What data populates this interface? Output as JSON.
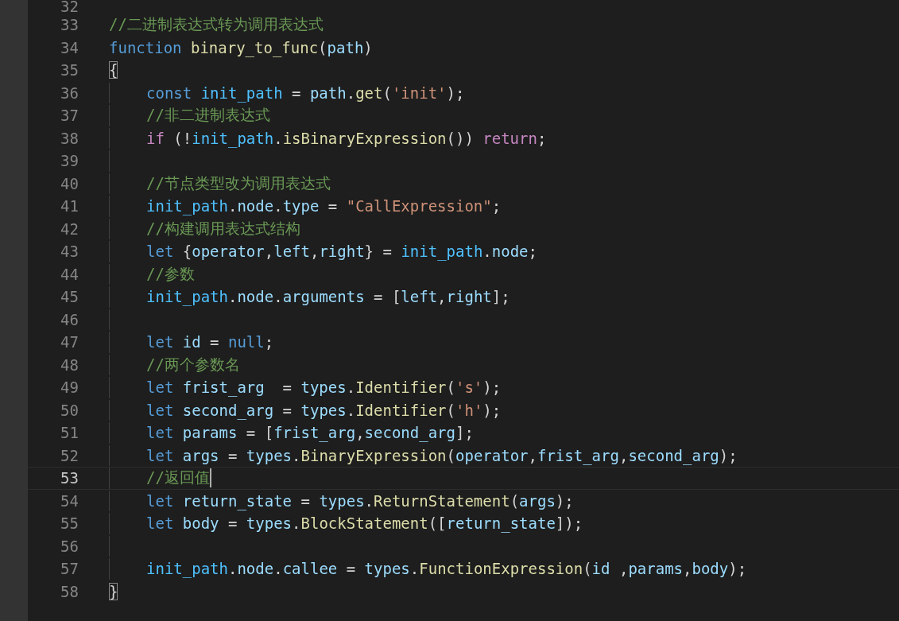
{
  "editor": {
    "lines": [
      {
        "number": "32",
        "current": false,
        "indented": false
      },
      {
        "number": "33",
        "current": false,
        "indented": false,
        "tokens": [
          {
            "kind": "comment",
            "text": "//二进制表达式转为调用表达式"
          }
        ]
      },
      {
        "number": "34",
        "current": false,
        "indented": false,
        "tokens": [
          {
            "kind": "keyword",
            "text": "function"
          },
          {
            "kind": "function",
            "text": " binary_to_func"
          },
          {
            "kind": "plain",
            "text": "("
          },
          {
            "kind": "variable",
            "text": "path"
          },
          {
            "kind": "plain",
            "text": ")"
          }
        ]
      },
      {
        "number": "35",
        "current": false,
        "indented": false,
        "tokens": [
          {
            "kind": "brace_match",
            "text": "{"
          }
        ]
      },
      {
        "number": "36",
        "current": false,
        "indented": true,
        "tokens": [
          {
            "kind": "keyword",
            "text": "const"
          },
          {
            "kind": "constant",
            "text": " init_path"
          },
          {
            "kind": "plain",
            "text": " = "
          },
          {
            "kind": "variable",
            "text": "path"
          },
          {
            "kind": "plain",
            "text": "."
          },
          {
            "kind": "function",
            "text": "get"
          },
          {
            "kind": "plain",
            "text": "("
          },
          {
            "kind": "string",
            "text": "'init'"
          },
          {
            "kind": "plain",
            "text": ");"
          }
        ]
      },
      {
        "number": "37",
        "current": false,
        "indented": true,
        "tokens": [
          {
            "kind": "comment",
            "text": "//非二进制表达式"
          }
        ]
      },
      {
        "number": "38",
        "current": false,
        "indented": true,
        "tokens": [
          {
            "kind": "control",
            "text": "if"
          },
          {
            "kind": "plain",
            "text": " (!"
          },
          {
            "kind": "constant",
            "text": "init_path"
          },
          {
            "kind": "plain",
            "text": "."
          },
          {
            "kind": "function",
            "text": "isBinaryExpression"
          },
          {
            "kind": "plain",
            "text": "()) "
          },
          {
            "kind": "control",
            "text": "return"
          },
          {
            "kind": "plain",
            "text": ";"
          }
        ]
      },
      {
        "number": "39",
        "current": false,
        "indented": true
      },
      {
        "number": "40",
        "current": false,
        "indented": true,
        "tokens": [
          {
            "kind": "comment",
            "text": "//节点类型改为调用表达式"
          }
        ]
      },
      {
        "number": "41",
        "current": false,
        "indented": true,
        "tokens": [
          {
            "kind": "constant",
            "text": "init_path"
          },
          {
            "kind": "plain",
            "text": "."
          },
          {
            "kind": "variable",
            "text": "node"
          },
          {
            "kind": "plain",
            "text": "."
          },
          {
            "kind": "variable",
            "text": "type"
          },
          {
            "kind": "plain",
            "text": " = "
          },
          {
            "kind": "string",
            "text": "\"CallExpression\""
          },
          {
            "kind": "plain",
            "text": ";"
          }
        ]
      },
      {
        "number": "42",
        "current": false,
        "indented": true,
        "tokens": [
          {
            "kind": "comment",
            "text": "//构建调用表达式结构"
          }
        ]
      },
      {
        "number": "43",
        "current": false,
        "indented": true,
        "tokens": [
          {
            "kind": "keyword",
            "text": "let"
          },
          {
            "kind": "plain",
            "text": " {"
          },
          {
            "kind": "variable",
            "text": "operator"
          },
          {
            "kind": "plain",
            "text": ","
          },
          {
            "kind": "variable",
            "text": "left"
          },
          {
            "kind": "plain",
            "text": ","
          },
          {
            "kind": "variable",
            "text": "right"
          },
          {
            "kind": "plain",
            "text": "} = "
          },
          {
            "kind": "constant",
            "text": "init_path"
          },
          {
            "kind": "plain",
            "text": "."
          },
          {
            "kind": "variable",
            "text": "node"
          },
          {
            "kind": "plain",
            "text": ";"
          }
        ]
      },
      {
        "number": "44",
        "current": false,
        "indented": true,
        "tokens": [
          {
            "kind": "comment",
            "text": "//参数"
          }
        ]
      },
      {
        "number": "45",
        "current": false,
        "indented": true,
        "tokens": [
          {
            "kind": "constant",
            "text": "init_path"
          },
          {
            "kind": "plain",
            "text": "."
          },
          {
            "kind": "variable",
            "text": "node"
          },
          {
            "kind": "plain",
            "text": "."
          },
          {
            "kind": "variable",
            "text": "arguments"
          },
          {
            "kind": "plain",
            "text": " = ["
          },
          {
            "kind": "variable",
            "text": "left"
          },
          {
            "kind": "plain",
            "text": ","
          },
          {
            "kind": "variable",
            "text": "right"
          },
          {
            "kind": "plain",
            "text": "];"
          }
        ]
      },
      {
        "number": "46",
        "current": false,
        "indented": true
      },
      {
        "number": "47",
        "current": false,
        "indented": true,
        "tokens": [
          {
            "kind": "keyword",
            "text": "let"
          },
          {
            "kind": "variable",
            "text": " id"
          },
          {
            "kind": "plain",
            "text": " = "
          },
          {
            "kind": "keyword",
            "text": "null"
          },
          {
            "kind": "plain",
            "text": ";"
          }
        ]
      },
      {
        "number": "48",
        "current": false,
        "indented": true,
        "tokens": [
          {
            "kind": "comment",
            "text": "//两个参数名"
          }
        ]
      },
      {
        "number": "49",
        "current": false,
        "indented": true,
        "tokens": [
          {
            "kind": "keyword",
            "text": "let"
          },
          {
            "kind": "variable",
            "text": " frist_arg"
          },
          {
            "kind": "plain",
            "text": "  = "
          },
          {
            "kind": "variable",
            "text": "types"
          },
          {
            "kind": "plain",
            "text": "."
          },
          {
            "kind": "function",
            "text": "Identifier"
          },
          {
            "kind": "plain",
            "text": "("
          },
          {
            "kind": "string",
            "text": "'s'"
          },
          {
            "kind": "plain",
            "text": ");"
          }
        ]
      },
      {
        "number": "50",
        "current": false,
        "indented": true,
        "tokens": [
          {
            "kind": "keyword",
            "text": "let"
          },
          {
            "kind": "variable",
            "text": " second_arg"
          },
          {
            "kind": "plain",
            "text": " = "
          },
          {
            "kind": "variable",
            "text": "types"
          },
          {
            "kind": "plain",
            "text": "."
          },
          {
            "kind": "function",
            "text": "Identifier"
          },
          {
            "kind": "plain",
            "text": "("
          },
          {
            "kind": "string",
            "text": "'h'"
          },
          {
            "kind": "plain",
            "text": ");"
          }
        ]
      },
      {
        "number": "51",
        "current": false,
        "indented": true,
        "tokens": [
          {
            "kind": "keyword",
            "text": "let"
          },
          {
            "kind": "variable",
            "text": " params"
          },
          {
            "kind": "plain",
            "text": " = ["
          },
          {
            "kind": "variable",
            "text": "frist_arg"
          },
          {
            "kind": "plain",
            "text": ","
          },
          {
            "kind": "variable",
            "text": "second_arg"
          },
          {
            "kind": "plain",
            "text": "];"
          }
        ]
      },
      {
        "number": "52",
        "current": false,
        "indented": true,
        "tokens": [
          {
            "kind": "keyword",
            "text": "let"
          },
          {
            "kind": "variable",
            "text": " args"
          },
          {
            "kind": "plain",
            "text": " = "
          },
          {
            "kind": "variable",
            "text": "types"
          },
          {
            "kind": "plain",
            "text": "."
          },
          {
            "kind": "function",
            "text": "BinaryExpression"
          },
          {
            "kind": "plain",
            "text": "("
          },
          {
            "kind": "variable",
            "text": "operator"
          },
          {
            "kind": "plain",
            "text": ","
          },
          {
            "kind": "variable",
            "text": "frist_arg"
          },
          {
            "kind": "plain",
            "text": ","
          },
          {
            "kind": "variable",
            "text": "second_arg"
          },
          {
            "kind": "plain",
            "text": ");"
          }
        ]
      },
      {
        "number": "53",
        "current": true,
        "indented": true,
        "tokens": [
          {
            "kind": "comment",
            "text": "//返回值"
          }
        ]
      },
      {
        "number": "54",
        "current": false,
        "indented": true,
        "tokens": [
          {
            "kind": "keyword",
            "text": "let"
          },
          {
            "kind": "variable",
            "text": " return_state"
          },
          {
            "kind": "plain",
            "text": " = "
          },
          {
            "kind": "variable",
            "text": "types"
          },
          {
            "kind": "plain",
            "text": "."
          },
          {
            "kind": "function",
            "text": "ReturnStatement"
          },
          {
            "kind": "plain",
            "text": "("
          },
          {
            "kind": "variable",
            "text": "args"
          },
          {
            "kind": "plain",
            "text": ");"
          }
        ]
      },
      {
        "number": "55",
        "current": false,
        "indented": true,
        "tokens": [
          {
            "kind": "keyword",
            "text": "let"
          },
          {
            "kind": "variable",
            "text": " body"
          },
          {
            "kind": "plain",
            "text": " = "
          },
          {
            "kind": "variable",
            "text": "types"
          },
          {
            "kind": "plain",
            "text": "."
          },
          {
            "kind": "function",
            "text": "BlockStatement"
          },
          {
            "kind": "plain",
            "text": "(["
          },
          {
            "kind": "variable",
            "text": "return_state"
          },
          {
            "kind": "plain",
            "text": "]);"
          }
        ]
      },
      {
        "number": "56",
        "current": false,
        "indented": true
      },
      {
        "number": "57",
        "current": false,
        "indented": true,
        "tokens": [
          {
            "kind": "constant",
            "text": "init_path"
          },
          {
            "kind": "plain",
            "text": "."
          },
          {
            "kind": "variable",
            "text": "node"
          },
          {
            "kind": "plain",
            "text": "."
          },
          {
            "kind": "variable",
            "text": "callee"
          },
          {
            "kind": "plain",
            "text": " = "
          },
          {
            "kind": "variable",
            "text": "types"
          },
          {
            "kind": "plain",
            "text": "."
          },
          {
            "kind": "function",
            "text": "FunctionExpression"
          },
          {
            "kind": "plain",
            "text": "("
          },
          {
            "kind": "variable",
            "text": "id"
          },
          {
            "kind": "plain",
            "text": " ,"
          },
          {
            "kind": "variable",
            "text": "params"
          },
          {
            "kind": "plain",
            "text": ","
          },
          {
            "kind": "variable",
            "text": "body"
          },
          {
            "kind": "plain",
            "text": ");"
          }
        ]
      },
      {
        "number": "58",
        "current": false,
        "indented": false,
        "tokens": [
          {
            "kind": "brace_match",
            "text": "}"
          }
        ]
      }
    ]
  }
}
